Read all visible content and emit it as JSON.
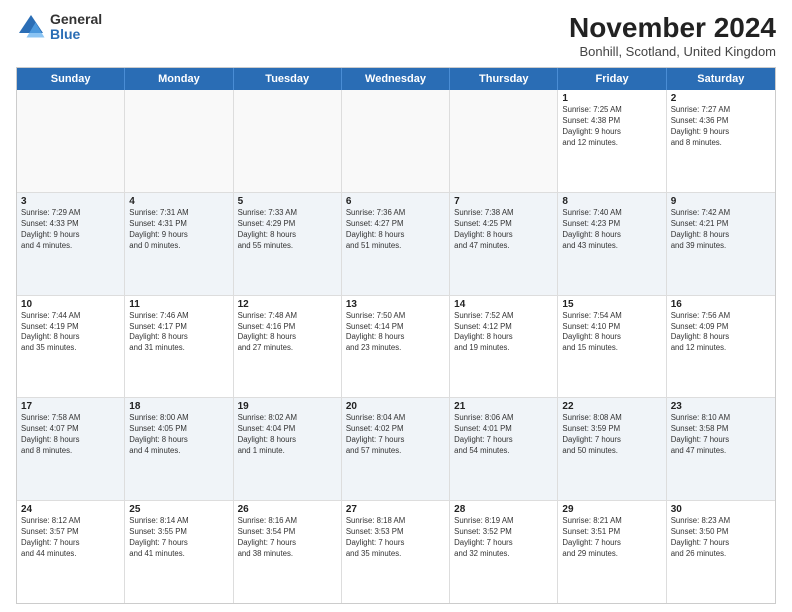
{
  "logo": {
    "general": "General",
    "blue": "Blue"
  },
  "title": "November 2024",
  "subtitle": "Bonhill, Scotland, United Kingdom",
  "days": [
    "Sunday",
    "Monday",
    "Tuesday",
    "Wednesday",
    "Thursday",
    "Friday",
    "Saturday"
  ],
  "rows": [
    [
      {
        "day": "",
        "empty": true
      },
      {
        "day": "",
        "empty": true
      },
      {
        "day": "",
        "empty": true
      },
      {
        "day": "",
        "empty": true
      },
      {
        "day": "",
        "empty": true
      },
      {
        "day": "1",
        "lines": [
          "Sunrise: 7:25 AM",
          "Sunset: 4:38 PM",
          "Daylight: 9 hours",
          "and 12 minutes."
        ]
      },
      {
        "day": "2",
        "lines": [
          "Sunrise: 7:27 AM",
          "Sunset: 4:36 PM",
          "Daylight: 9 hours",
          "and 8 minutes."
        ]
      }
    ],
    [
      {
        "day": "3",
        "lines": [
          "Sunrise: 7:29 AM",
          "Sunset: 4:33 PM",
          "Daylight: 9 hours",
          "and 4 minutes."
        ]
      },
      {
        "day": "4",
        "lines": [
          "Sunrise: 7:31 AM",
          "Sunset: 4:31 PM",
          "Daylight: 9 hours",
          "and 0 minutes."
        ]
      },
      {
        "day": "5",
        "lines": [
          "Sunrise: 7:33 AM",
          "Sunset: 4:29 PM",
          "Daylight: 8 hours",
          "and 55 minutes."
        ]
      },
      {
        "day": "6",
        "lines": [
          "Sunrise: 7:36 AM",
          "Sunset: 4:27 PM",
          "Daylight: 8 hours",
          "and 51 minutes."
        ]
      },
      {
        "day": "7",
        "lines": [
          "Sunrise: 7:38 AM",
          "Sunset: 4:25 PM",
          "Daylight: 8 hours",
          "and 47 minutes."
        ]
      },
      {
        "day": "8",
        "lines": [
          "Sunrise: 7:40 AM",
          "Sunset: 4:23 PM",
          "Daylight: 8 hours",
          "and 43 minutes."
        ]
      },
      {
        "day": "9",
        "lines": [
          "Sunrise: 7:42 AM",
          "Sunset: 4:21 PM",
          "Daylight: 8 hours",
          "and 39 minutes."
        ]
      }
    ],
    [
      {
        "day": "10",
        "lines": [
          "Sunrise: 7:44 AM",
          "Sunset: 4:19 PM",
          "Daylight: 8 hours",
          "and 35 minutes."
        ]
      },
      {
        "day": "11",
        "lines": [
          "Sunrise: 7:46 AM",
          "Sunset: 4:17 PM",
          "Daylight: 8 hours",
          "and 31 minutes."
        ]
      },
      {
        "day": "12",
        "lines": [
          "Sunrise: 7:48 AM",
          "Sunset: 4:16 PM",
          "Daylight: 8 hours",
          "and 27 minutes."
        ]
      },
      {
        "day": "13",
        "lines": [
          "Sunrise: 7:50 AM",
          "Sunset: 4:14 PM",
          "Daylight: 8 hours",
          "and 23 minutes."
        ]
      },
      {
        "day": "14",
        "lines": [
          "Sunrise: 7:52 AM",
          "Sunset: 4:12 PM",
          "Daylight: 8 hours",
          "and 19 minutes."
        ]
      },
      {
        "day": "15",
        "lines": [
          "Sunrise: 7:54 AM",
          "Sunset: 4:10 PM",
          "Daylight: 8 hours",
          "and 15 minutes."
        ]
      },
      {
        "day": "16",
        "lines": [
          "Sunrise: 7:56 AM",
          "Sunset: 4:09 PM",
          "Daylight: 8 hours",
          "and 12 minutes."
        ]
      }
    ],
    [
      {
        "day": "17",
        "lines": [
          "Sunrise: 7:58 AM",
          "Sunset: 4:07 PM",
          "Daylight: 8 hours",
          "and 8 minutes."
        ]
      },
      {
        "day": "18",
        "lines": [
          "Sunrise: 8:00 AM",
          "Sunset: 4:05 PM",
          "Daylight: 8 hours",
          "and 4 minutes."
        ]
      },
      {
        "day": "19",
        "lines": [
          "Sunrise: 8:02 AM",
          "Sunset: 4:04 PM",
          "Daylight: 8 hours",
          "and 1 minute."
        ]
      },
      {
        "day": "20",
        "lines": [
          "Sunrise: 8:04 AM",
          "Sunset: 4:02 PM",
          "Daylight: 7 hours",
          "and 57 minutes."
        ]
      },
      {
        "day": "21",
        "lines": [
          "Sunrise: 8:06 AM",
          "Sunset: 4:01 PM",
          "Daylight: 7 hours",
          "and 54 minutes."
        ]
      },
      {
        "day": "22",
        "lines": [
          "Sunrise: 8:08 AM",
          "Sunset: 3:59 PM",
          "Daylight: 7 hours",
          "and 50 minutes."
        ]
      },
      {
        "day": "23",
        "lines": [
          "Sunrise: 8:10 AM",
          "Sunset: 3:58 PM",
          "Daylight: 7 hours",
          "and 47 minutes."
        ]
      }
    ],
    [
      {
        "day": "24",
        "lines": [
          "Sunrise: 8:12 AM",
          "Sunset: 3:57 PM",
          "Daylight: 7 hours",
          "and 44 minutes."
        ]
      },
      {
        "day": "25",
        "lines": [
          "Sunrise: 8:14 AM",
          "Sunset: 3:55 PM",
          "Daylight: 7 hours",
          "and 41 minutes."
        ]
      },
      {
        "day": "26",
        "lines": [
          "Sunrise: 8:16 AM",
          "Sunset: 3:54 PM",
          "Daylight: 7 hours",
          "and 38 minutes."
        ]
      },
      {
        "day": "27",
        "lines": [
          "Sunrise: 8:18 AM",
          "Sunset: 3:53 PM",
          "Daylight: 7 hours",
          "and 35 minutes."
        ]
      },
      {
        "day": "28",
        "lines": [
          "Sunrise: 8:19 AM",
          "Sunset: 3:52 PM",
          "Daylight: 7 hours",
          "and 32 minutes."
        ]
      },
      {
        "day": "29",
        "lines": [
          "Sunrise: 8:21 AM",
          "Sunset: 3:51 PM",
          "Daylight: 7 hours",
          "and 29 minutes."
        ]
      },
      {
        "day": "30",
        "lines": [
          "Sunrise: 8:23 AM",
          "Sunset: 3:50 PM",
          "Daylight: 7 hours",
          "and 26 minutes."
        ]
      }
    ]
  ]
}
